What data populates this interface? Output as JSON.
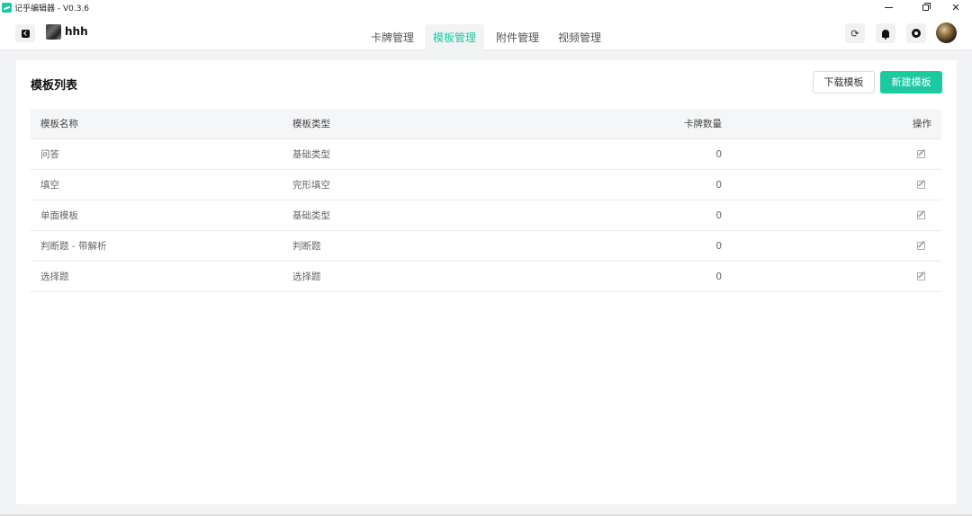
{
  "window": {
    "title": "记乎编辑器 - V0.3.6"
  },
  "header": {
    "deck_name": "hhh",
    "tabs": [
      {
        "label": "卡牌管理",
        "active": false
      },
      {
        "label": "模板管理",
        "active": true
      },
      {
        "label": "附件管理",
        "active": false
      },
      {
        "label": "视频管理",
        "active": false
      }
    ],
    "icons": [
      "back-icon",
      "refresh-icon",
      "bell-icon",
      "settings-icon",
      "avatar"
    ]
  },
  "main": {
    "title": "模板列表",
    "download_label": "下载模板",
    "new_label": "新建模板",
    "columns": {
      "name": "模板名称",
      "type": "模板类型",
      "count": "卡牌数量",
      "op": "操作"
    },
    "rows": [
      {
        "name": "问答",
        "type": "基础类型",
        "count": "0"
      },
      {
        "name": "填空",
        "type": "完形填空",
        "count": "0"
      },
      {
        "name": "单面模板",
        "type": "基础类型",
        "count": "0"
      },
      {
        "name": "判断题 - 带解析",
        "type": "判断题",
        "count": "0"
      },
      {
        "name": "选择题",
        "type": "选择题",
        "count": "0"
      }
    ]
  },
  "colors": {
    "accent": "#1cc9a0",
    "background": "#f2f3f5"
  }
}
